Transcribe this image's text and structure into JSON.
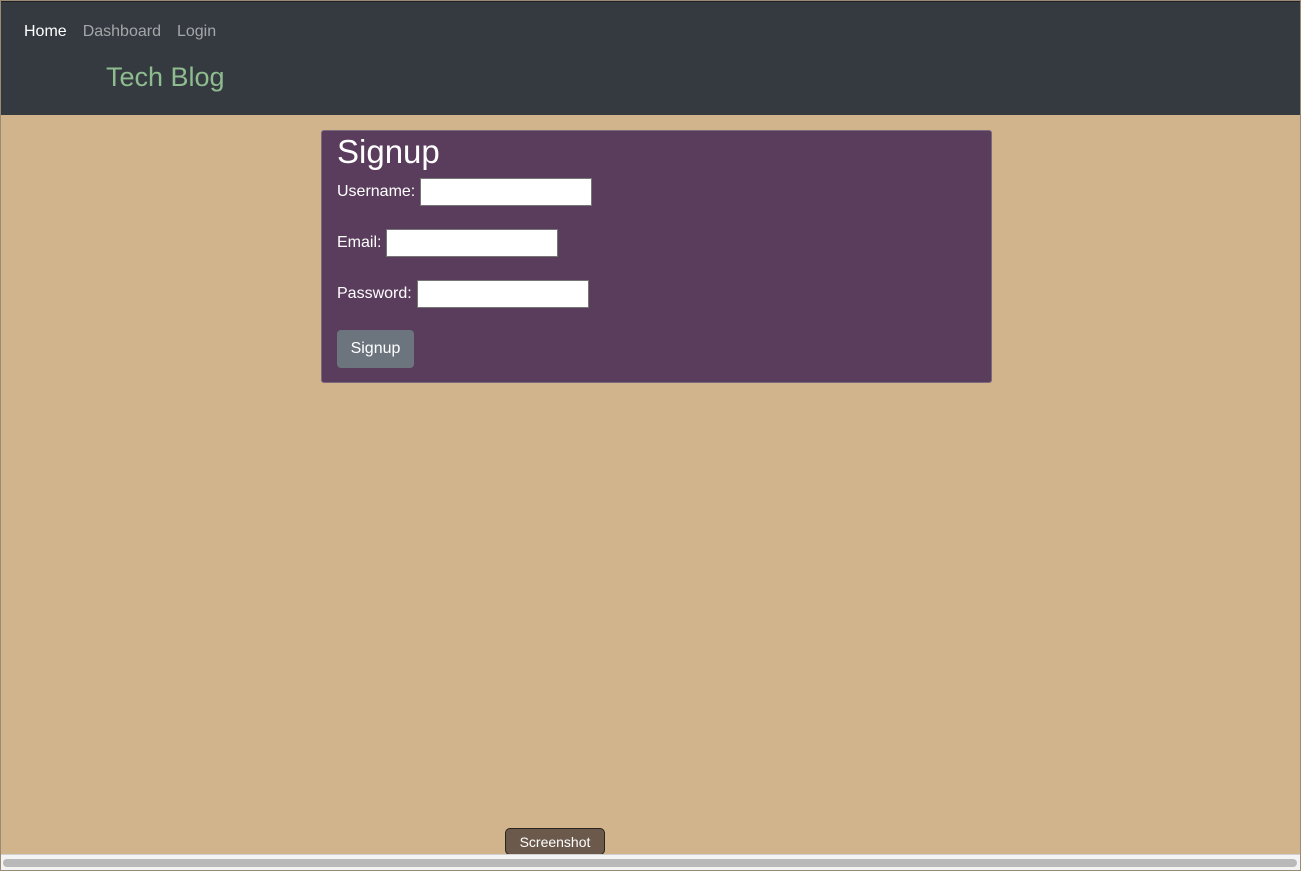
{
  "nav": {
    "items": [
      {
        "label": "Home",
        "active": true
      },
      {
        "label": "Dashboard",
        "active": false
      },
      {
        "label": "Login",
        "active": false
      }
    ]
  },
  "brand": {
    "title": "Tech Blog"
  },
  "signup": {
    "heading": "Signup",
    "username_label": "Username:",
    "username_value": "",
    "email_label": "Email:",
    "email_value": "",
    "password_label": "Password:",
    "password_value": "",
    "button_label": "Signup"
  },
  "tooltip": {
    "text": "Screenshot"
  },
  "colors": {
    "navbar_bg": "#343a40",
    "page_bg": "#d2b48c",
    "card_bg": "#5a3d5c",
    "brand": "#8fbc8f",
    "button_bg": "#6c757d"
  }
}
